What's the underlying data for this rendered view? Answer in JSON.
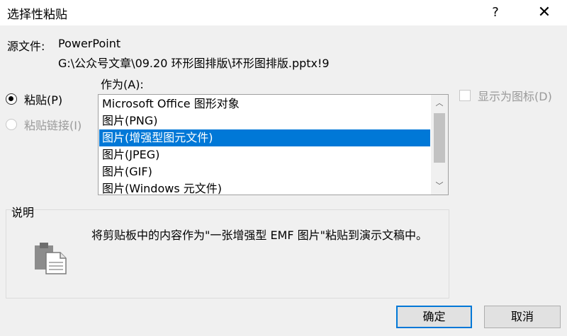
{
  "window": {
    "title": "选择性粘贴",
    "help_glyph": "?",
    "close_glyph": "✕"
  },
  "source": {
    "label": "源文件:",
    "app": "PowerPoint",
    "path": "G:\\公众号文章\\09.20 环形图排版\\环形图排版.pptx!9"
  },
  "options": {
    "paste": {
      "label": "粘贴(P)",
      "checked": true
    },
    "paste_link": {
      "label": "粘贴链接(I)",
      "checked": false,
      "disabled": true
    }
  },
  "as_label": "作为(A):",
  "list": {
    "items": [
      "Microsoft Office 图形对象",
      "图片(PNG)",
      "图片(增强型图元文件)",
      "图片(JPEG)",
      "图片(GIF)",
      "图片(Windows 元文件)"
    ],
    "selected_index": 2
  },
  "show_as_icon": {
    "label": "显示为图标(D)",
    "checked": false,
    "disabled": true
  },
  "description": {
    "label": "说明",
    "text": "将剪贴板中的内容作为\"一张增强型 EMF 图片\"粘贴到演示文稿中。"
  },
  "buttons": {
    "ok": "确定",
    "cancel": "取消"
  },
  "colors": {
    "selection": "#0078d7",
    "background": "#f0f0f0"
  }
}
